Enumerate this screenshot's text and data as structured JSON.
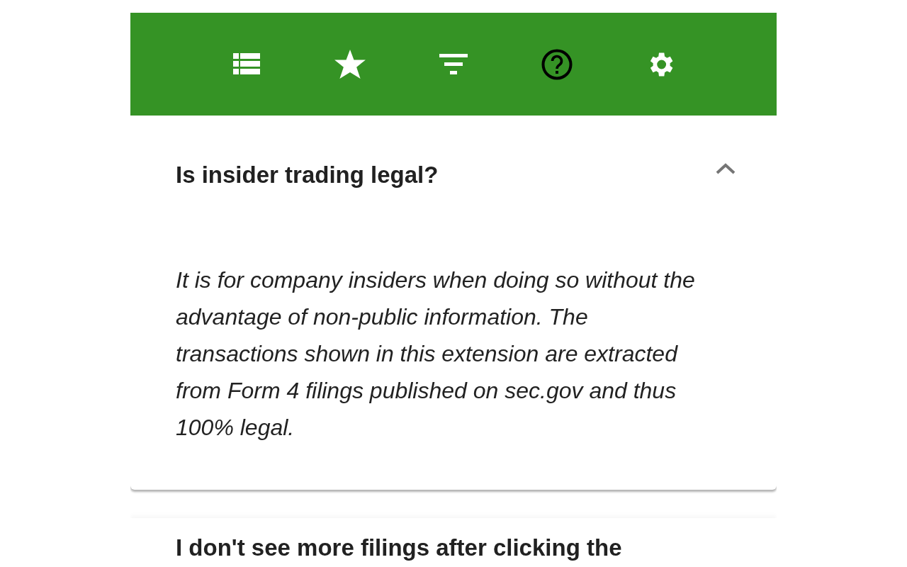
{
  "toolbar": {
    "tabs": [
      {
        "kind": "list",
        "selected": false
      },
      {
        "kind": "star",
        "selected": false
      },
      {
        "kind": "filter",
        "selected": false
      },
      {
        "kind": "help",
        "selected": true
      },
      {
        "kind": "settings",
        "selected": false
      }
    ]
  },
  "faq": [
    {
      "question": "Is insider trading legal?",
      "expanded": true,
      "answer": "It is for company insiders when doing so without the advantage of non-public information. The transactions shown in this extension are extracted from Form 4 filings published on sec.gov and thus 100% legal."
    },
    {
      "question": "I don't see more filings after clicking the"
    }
  ]
}
